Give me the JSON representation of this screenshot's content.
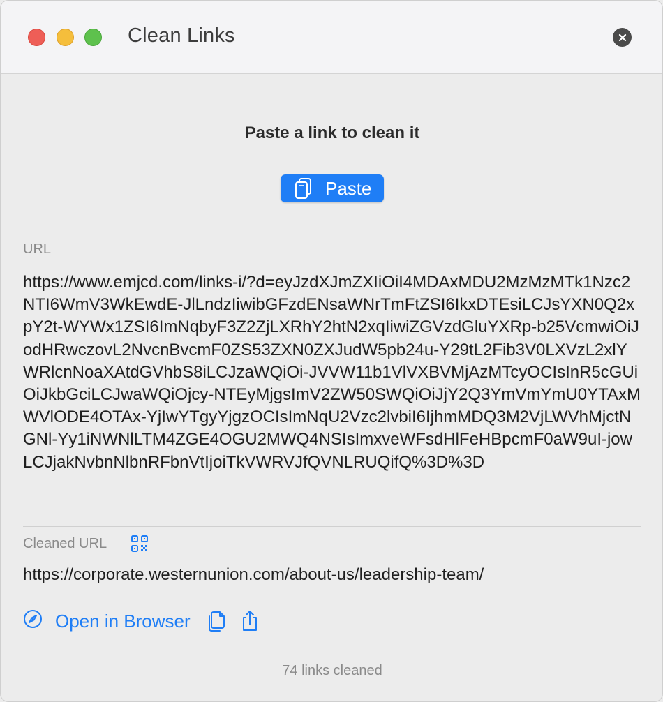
{
  "window": {
    "title": "Clean Links"
  },
  "main": {
    "heading": "Paste a link to clean it",
    "paste_label": "Paste"
  },
  "url_section": {
    "label": "URL",
    "value": "https://www.emjcd.com/links-i/?d=eyJzdXJmZXIiOiI4MDAxMDU2MzMzMTk1Nzc2NTI6WmV3WkEwdE-JlLndzIiwibGFzdENsaWNrTmFtZSI6IkxDTEsiLCJsYXN0Q2xpY2t-WYWx1ZSI6ImNqbyF3Z2ZjLXRhY2htN2xqIiwiZGVzdGluYXRp-b25VcmwiOiJodHRwczovL2NvcnBvcmF0ZS53ZXN0ZXJudW5pb24u-Y29tL2Fib3V0LXVzL2xlYWRlcnNoaXAtdGVhbS8iLCJzaWQiOi-JVVW11b1VlVXBVMjAzMTcyOCIsInR5cGUiOiJkbGciLCJwaWQiOjcy-NTEyMjgsImV2ZW50SWQiOiJjY2Q3YmVmYmU0YTAxMWVlODE4OTAx-YjIwYTgyYjgzOCIsImNqU2Vzc2lvbiI6IjhmMDQ3M2VjLWVhMjctNGNl-Yy1iNWNlLTM4ZGE4OGU2MWQ4NSIsImxveWFsdHlFeHBpcmF0aW9uI-jowLCJjakNvbnNlbnRFbnVtIjoiTkVWRVJfQVNLRUQifQ%3D%3D"
  },
  "cleaned_section": {
    "label": "Cleaned URL",
    "value": "https://corporate.westernunion.com/about-us/leadership-team/"
  },
  "actions": {
    "open_browser_label": "Open in Browser"
  },
  "footer": {
    "count_text": "74 links cleaned"
  },
  "colors": {
    "accent": "#1f7ef6",
    "close": "#ee5e57",
    "minimize": "#f5be3c",
    "zoom": "#5ec14d"
  },
  "icons": {
    "paste": "clipboard-icon",
    "qr": "qr-code-icon",
    "browser": "compass-icon",
    "copy": "copy-icon",
    "share": "share-icon",
    "close": "close-icon"
  }
}
